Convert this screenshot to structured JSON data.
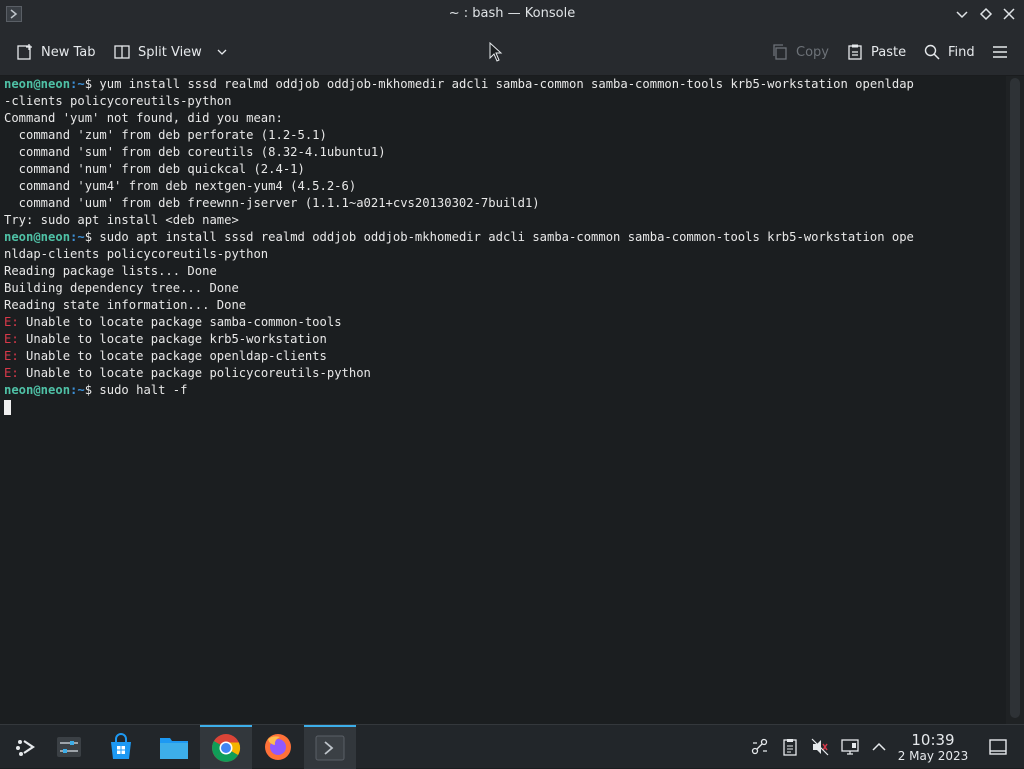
{
  "window": {
    "title": "~ : bash — Konsole"
  },
  "toolbar": {
    "new_tab": "New Tab",
    "split_view": "Split View",
    "copy": "Copy",
    "paste": "Paste",
    "find": "Find"
  },
  "terminal": {
    "prompt_user": "neon@neon",
    "prompt_path": ":~",
    "prompt_sym": "$ ",
    "cmd1": "yum install sssd realmd oddjob oddjob-mkhomedir adcli samba-common samba-common-tools krb5-workstation openldap",
    "cmd1_wrap": "-clients policycoreutils-python",
    "l1": "Command 'yum' not found, did you mean:",
    "l2": "  command 'zum' from deb perforate (1.2-5.1)",
    "l3": "  command 'sum' from deb coreutils (8.32-4.1ubuntu1)",
    "l4": "  command 'num' from deb quickcal (2.4-1)",
    "l5": "  command 'yum4' from deb nextgen-yum4 (4.5.2-6)",
    "l6": "  command 'uum' from deb freewnn-jserver (1.1.1~a021+cvs20130302-7build1)",
    "l7": "Try: sudo apt install <deb name>",
    "cmd2": "sudo apt install sssd realmd oddjob oddjob-mkhomedir adcli samba-common samba-common-tools krb5-workstation ope",
    "cmd2_wrap": "nldap-clients policycoreutils-python",
    "l8": "Reading package lists... Done",
    "l9": "Building dependency tree... Done",
    "l10": "Reading state information... Done",
    "err_prefix": "E:",
    "e1": " Unable to locate package samba-common-tools",
    "e2": " Unable to locate package krb5-workstation",
    "e3": " Unable to locate package openldap-clients",
    "e4": " Unable to locate package policycoreutils-python",
    "cmd3": "sudo halt -f"
  },
  "taskbar": {
    "time": "10:39",
    "date": "2 May 2023"
  },
  "colors": {
    "prompt_user": "#4fc1a6",
    "prompt_path": "#3c8fd6",
    "error": "#d8394a",
    "accent": "#3daee9"
  }
}
